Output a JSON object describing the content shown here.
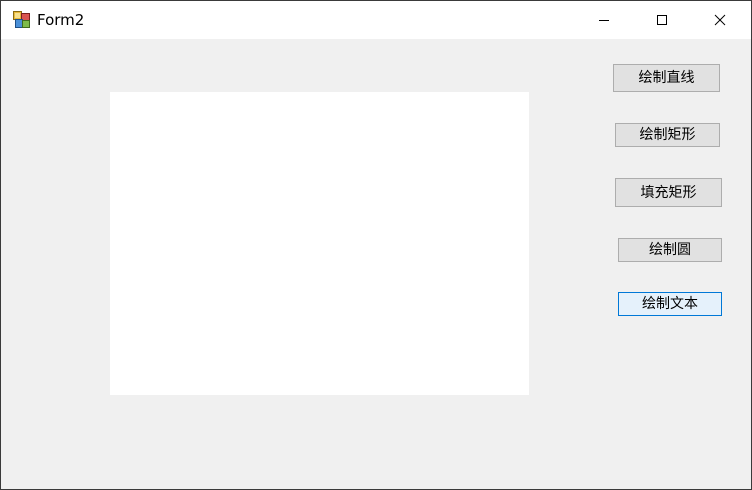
{
  "window": {
    "title": "Form2"
  },
  "titlebar": {
    "icons": {
      "app": "app-form-icon",
      "minimize": "minimize-icon",
      "maximize": "maximize-icon",
      "close": "close-icon"
    }
  },
  "buttons": {
    "draw_line": "绘制直线",
    "draw_rect": "绘制矩形",
    "fill_rect": "填充矩形",
    "draw_circle": "绘制圆",
    "draw_text": "绘制文本"
  },
  "colors": {
    "form_background": "#f0f0f0",
    "canvas_background": "#ffffff",
    "button_face": "#e1e1e1",
    "focus_border": "#0078d7"
  }
}
